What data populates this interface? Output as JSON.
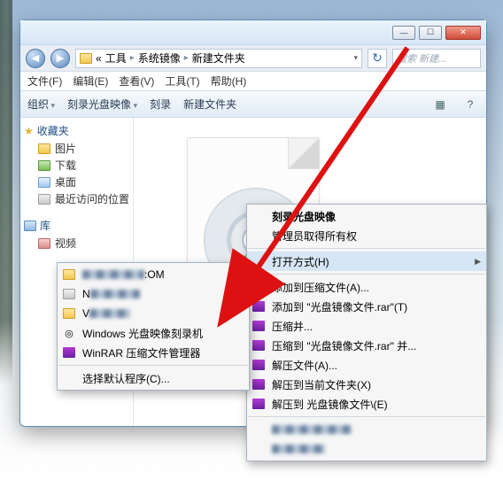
{
  "titlebar": {
    "min": "—",
    "max": "☐",
    "close": "✕"
  },
  "nav": {
    "back_glyph": "◀",
    "fwd_glyph": "▶",
    "crumb_prefix": "«",
    "crumb1": "工具",
    "crumb2": "系统镜像",
    "crumb3": "新建文件夹",
    "refresh_glyph": "↻",
    "search_placeholder": "搜索 新建..."
  },
  "menubar": {
    "file": "文件(F)",
    "edit": "编辑(E)",
    "view": "查看(V)",
    "tools": "工具(T)",
    "help": "帮助(H)"
  },
  "toolbar": {
    "organize": "组织",
    "burn_image": "刻录光盘映像",
    "burn": "刻录",
    "new_folder": "新建文件夹",
    "view_glyph": "▦",
    "help_glyph": "?"
  },
  "sidebar": {
    "favorites": {
      "header": "收藏夹",
      "items": [
        "图片",
        "下载",
        "桌面",
        "最近访问的位置"
      ]
    },
    "libraries": {
      "header": "库",
      "items": [
        "视频"
      ]
    }
  },
  "submenu_left": {
    "item_com_suffix": ":OM",
    "item_windows_burner": "Windows 光盘映像刻录机",
    "item_winrar": "WinRAR 压缩文件管理器",
    "item_choose_default": "选择默认程序(C)..."
  },
  "context_main": {
    "burn_image": "刻录光盘映像",
    "admin_own": "管理员取得所有权",
    "open_with": "打开方式(H)",
    "add_archive": "添加到压缩文件(A)...",
    "add_rar": "添加到 \"光盘镜像文件.rar\"(T)",
    "compress_email": "压缩并...",
    "compress_rar_email": "压缩到 \"光盘镜像文件.rar\" 并...",
    "extract": "解压文件(A)...",
    "extract_here": "解压到当前文件夹(X)",
    "extract_to": "解压到 光盘镜像文件\\(E)"
  }
}
